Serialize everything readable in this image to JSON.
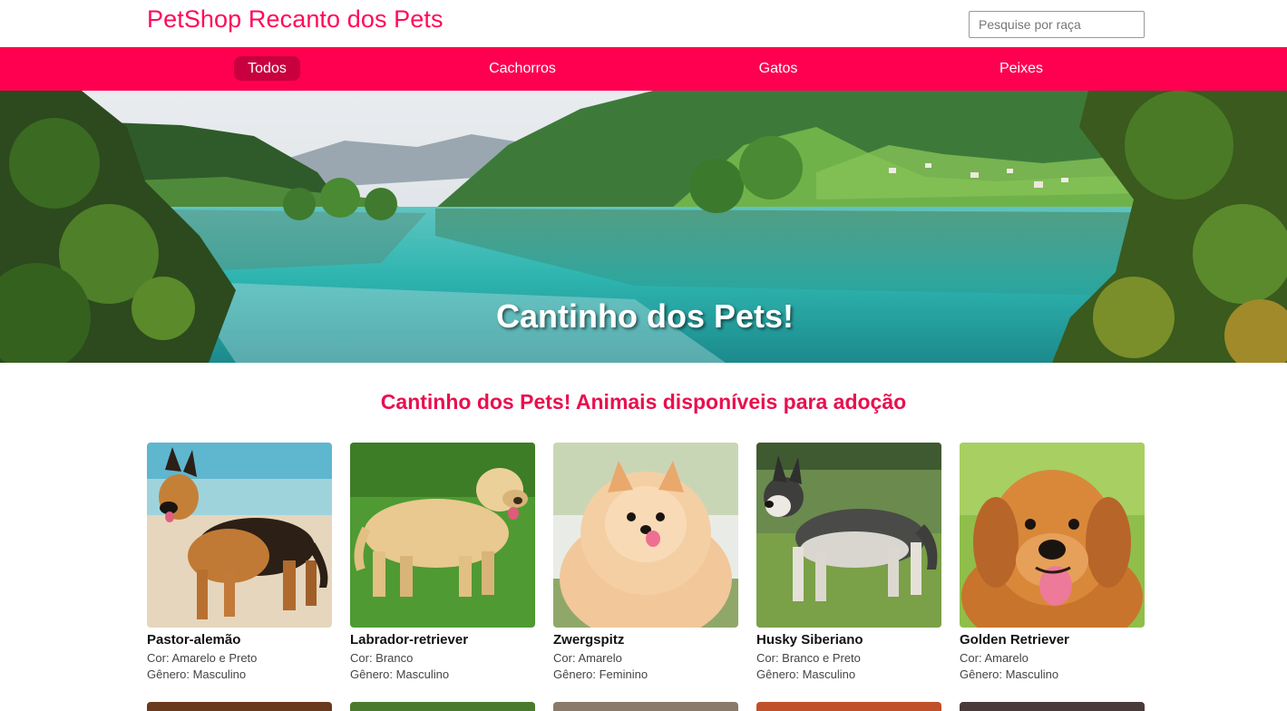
{
  "header": {
    "brand": "PetShop Recanto dos Pets",
    "search_placeholder": "Pesquise por raça"
  },
  "nav": {
    "items": [
      {
        "label": "Todos",
        "active": true
      },
      {
        "label": "Cachorros",
        "active": false
      },
      {
        "label": "Gatos",
        "active": false
      },
      {
        "label": "Peixes",
        "active": false
      }
    ]
  },
  "hero": {
    "title": "Cantinho dos Pets!"
  },
  "section": {
    "title": "Cantinho dos Pets! Animais disponíveis para adoção"
  },
  "pets": [
    {
      "name": "Pastor-alemão",
      "color": "Cor: Amarelo e Preto",
      "gender": "Gênero: Masculino"
    },
    {
      "name": "Labrador-retriever",
      "color": "Cor: Branco",
      "gender": "Gênero: Masculino"
    },
    {
      "name": "Zwergspitz",
      "color": "Cor: Amarelo",
      "gender": "Gênero: Feminino"
    },
    {
      "name": "Husky Siberiano",
      "color": "Cor: Branco e Preto",
      "gender": "Gênero: Masculino"
    },
    {
      "name": "Golden Retriever",
      "color": "Cor: Amarelo",
      "gender": "Gênero: Masculino"
    }
  ],
  "colors": {
    "brand": "#ff0a5a",
    "nav_bg": "#ff0050",
    "nav_active": "#c8003f",
    "section_title": "#e8104f"
  }
}
